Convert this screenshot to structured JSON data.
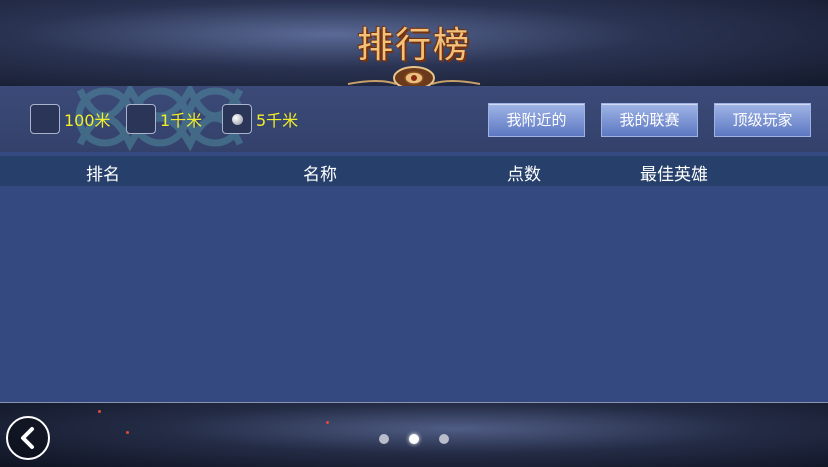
{
  "header": {
    "title": "排行榜"
  },
  "filters": [
    {
      "label": "100米",
      "selected": false
    },
    {
      "label": "1千米",
      "selected": false
    },
    {
      "label": "5千米",
      "selected": true
    }
  ],
  "tabs": [
    {
      "label": "我附近的"
    },
    {
      "label": "我的联赛"
    },
    {
      "label": "顶级玩家"
    }
  ],
  "table": {
    "columns": [
      "排名",
      "名称",
      "点数",
      "最佳英雄"
    ],
    "rows": []
  },
  "pagination": {
    "total": 3,
    "current": 2
  },
  "icons": {
    "back": "chevron-left-icon",
    "ornament": "crest-ornament-icon"
  },
  "colors": {
    "title": "#f2c27b",
    "filter_label": "#f2ee2a",
    "panel": "#34497f",
    "table_header": "#26406b"
  }
}
